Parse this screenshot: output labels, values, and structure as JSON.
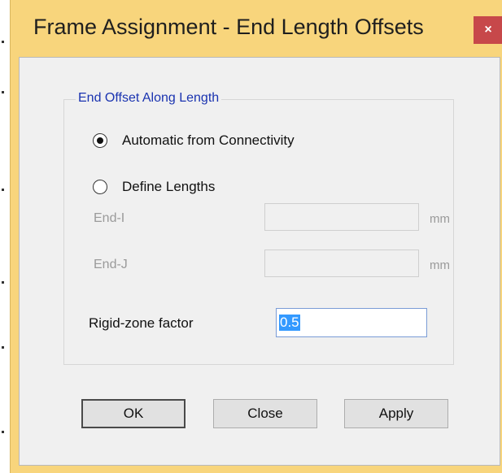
{
  "window": {
    "title": "Frame Assignment - End Length Offsets",
    "close_glyph": "×"
  },
  "group": {
    "legend": "End Offset Along Length"
  },
  "options": {
    "automatic_label": "Automatic from Connectivity",
    "automatic_selected": true,
    "define_label": "Define Lengths",
    "define_selected": false
  },
  "fields": {
    "end_i_label": "End-I",
    "end_i_value": "",
    "end_i_unit": "mm",
    "end_j_label": "End-J",
    "end_j_value": "",
    "end_j_unit": "mm",
    "rigid_label": "Rigid-zone factor",
    "rigid_value": "0.5"
  },
  "buttons": {
    "ok": "OK",
    "close": "Close",
    "apply": "Apply"
  },
  "colors": {
    "titlebar": "#f8d57c",
    "close_button": "#c7484a",
    "legend_text": "#1a33b0",
    "selection": "#3399ff"
  }
}
